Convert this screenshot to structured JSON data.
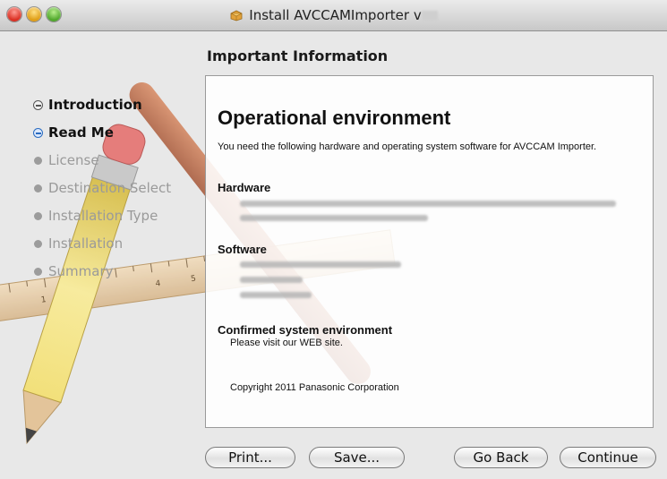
{
  "window": {
    "title": "Install AVCCAMImporter v",
    "pane_title": "Important Information"
  },
  "steps": [
    {
      "label": "Introduction",
      "state": "done"
    },
    {
      "label": "Read Me",
      "state": "current"
    },
    {
      "label": "License",
      "state": "pending"
    },
    {
      "label": "Destination Select",
      "state": "pending"
    },
    {
      "label": "Installation Type",
      "state": "pending"
    },
    {
      "label": "Installation",
      "state": "pending"
    },
    {
      "label": "Summary",
      "state": "pending"
    }
  ],
  "readme": {
    "heading": "Operational environment",
    "intro": "You need the following hardware and operating system software for AVCCAM Importer.",
    "hardware_heading": "Hardware",
    "software_heading": "Software",
    "confirmed_heading": "Confirmed system environment",
    "confirmed_text": "Please visit our WEB site.",
    "copyright": "Copyright 2011 Panasonic Corporation"
  },
  "buttons": {
    "print": "Print...",
    "save": "Save...",
    "go_back": "Go Back",
    "continue": "Continue"
  },
  "icons": {
    "app_icon": "package-box-icon"
  }
}
